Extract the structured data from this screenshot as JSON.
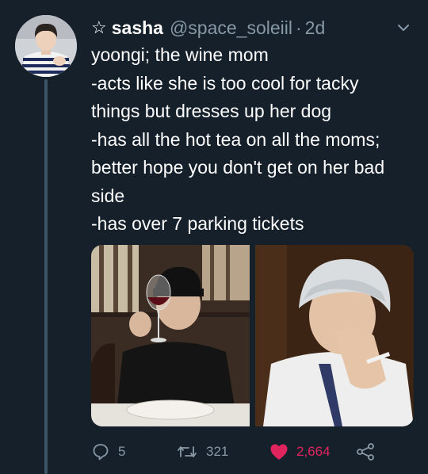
{
  "tweet": {
    "display_name": "sasha",
    "handle": "@space_soleiil",
    "separator": "·",
    "time": "2d",
    "lines": [
      "yoongi; the wine mom",
      "-acts like she is too cool for tacky",
      "things but dresses up her dog",
      "-has all the hot tea on all the moms;",
      "better hope you don't get on her bad",
      "side",
      "-has over 7 parking tickets"
    ]
  },
  "actions": {
    "replies": "5",
    "retweets": "321",
    "likes": "2,664"
  },
  "icons": {
    "star": "star-outline-icon",
    "caret": "chevron-down-icon",
    "reply": "reply-icon",
    "retweet": "retweet-icon",
    "like": "heart-icon",
    "share": "share-icon"
  },
  "colors": {
    "background": "#15202b",
    "secondary_text": "#8899a6",
    "like": "#e0245e",
    "thread_line": "#3d5466"
  }
}
